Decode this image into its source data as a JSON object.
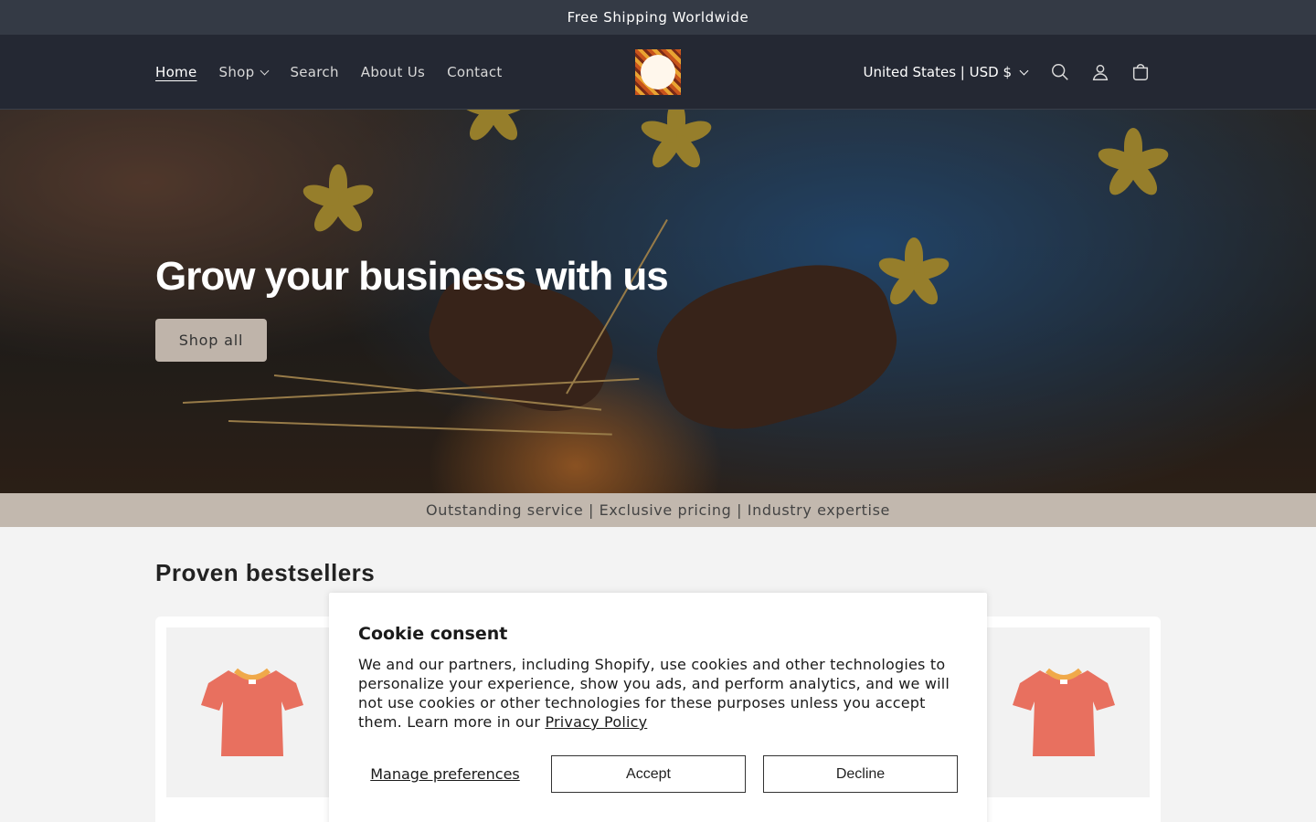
{
  "announcement": {
    "text": "Free Shipping Worldwide"
  },
  "header": {
    "nav": [
      {
        "label": "Home",
        "active": true
      },
      {
        "label": "Shop",
        "dropdown": true
      },
      {
        "label": "Search"
      },
      {
        "label": "About Us"
      },
      {
        "label": "Contact"
      }
    ],
    "currency": "United States | USD $",
    "icons": [
      "search-icon",
      "account-icon",
      "cart-icon"
    ]
  },
  "hero": {
    "title": "Grow your business with us",
    "button": "Shop all"
  },
  "strip": {
    "text": "Outstanding service | Exclusive pricing | Industry expertise"
  },
  "section": {
    "title": "Proven bestsellers"
  },
  "cookie": {
    "title": "Cookie consent",
    "text": "We and our partners, including Shopify, use cookies and other technologies to personalize your experience, show you ads, and perform analytics, and we will not use cookies or other technologies for these purposes unless you accept them. Learn more in our",
    "link": "Privacy Policy",
    "manage": "Manage preferences",
    "accept": "Accept",
    "decline": "Decline"
  },
  "colors": {
    "tshirt": "#e8705f",
    "collar": "#f0a94a",
    "header_bg": "#242833",
    "announcement_bg": "#343a45",
    "strip_bg": "#c2b8ae"
  }
}
